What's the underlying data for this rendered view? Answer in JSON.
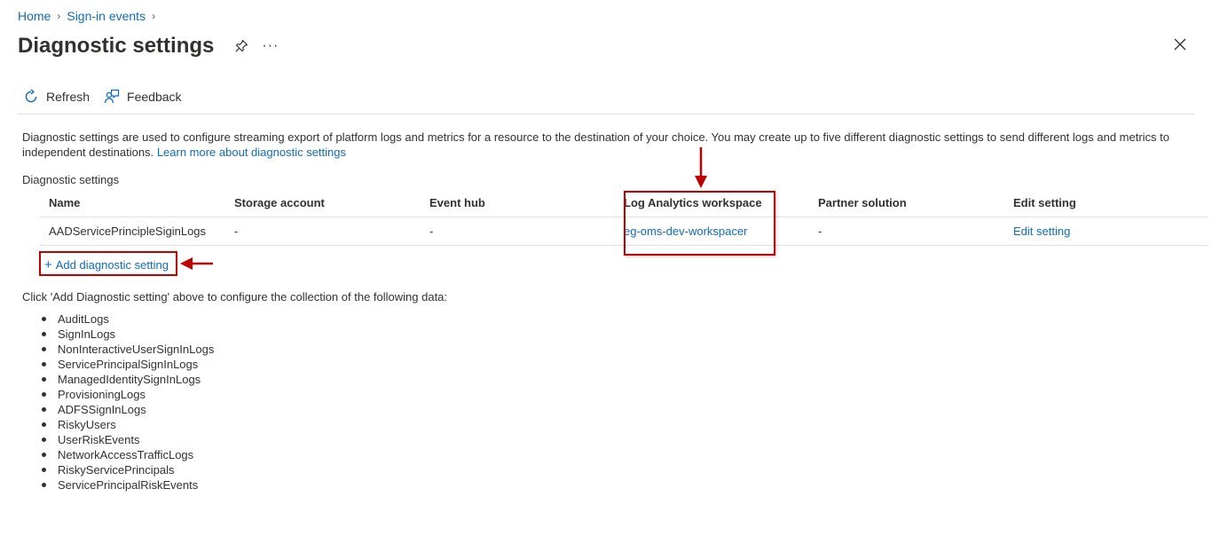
{
  "breadcrumb": [
    {
      "label": "Home"
    },
    {
      "label": "Sign-in events"
    }
  ],
  "page": {
    "title": "Diagnostic settings",
    "more_label": "···"
  },
  "toolbar": {
    "refresh_label": "Refresh",
    "feedback_label": "Feedback"
  },
  "description": {
    "text": "Diagnostic settings are used to configure streaming export of platform logs and metrics for a resource to the destination of your choice. You may create up to five different diagnostic settings to send different logs and metrics to independent destinations.",
    "link": "Learn more about diagnostic settings"
  },
  "section_label": "Diagnostic settings",
  "table": {
    "columns": [
      "Name",
      "Storage account",
      "Event hub",
      "Log Analytics workspace",
      "Partner solution",
      "Edit setting"
    ],
    "rows": [
      {
        "name": "AADServicePrincipleSiginLogs",
        "storage": "-",
        "event_hub": "-",
        "workspace": "eg-oms-dev-workspacer",
        "partner": "-",
        "edit": "Edit setting"
      }
    ]
  },
  "add_setting_label": "Add diagnostic setting",
  "info_text": "Click 'Add Diagnostic setting' above to configure the collection of the following data:",
  "log_categories": [
    "AuditLogs",
    "SignInLogs",
    "NonInteractiveUserSignInLogs",
    "ServicePrincipalSignInLogs",
    "ManagedIdentitySignInLogs",
    "ProvisioningLogs",
    "ADFSSignInLogs",
    "RiskyUsers",
    "UserRiskEvents",
    "NetworkAccessTrafficLogs",
    "RiskyServicePrincipals",
    "ServicePrincipalRiskEvents"
  ],
  "colors": {
    "link": "#0f6cbd",
    "text": "#323130",
    "annotation": "#c00000",
    "divider": "#e1dfdd"
  },
  "icons": [
    "pin-icon",
    "close-icon",
    "refresh-icon",
    "feedback-icon",
    "plus-icon",
    "chevron-right-icon"
  ]
}
